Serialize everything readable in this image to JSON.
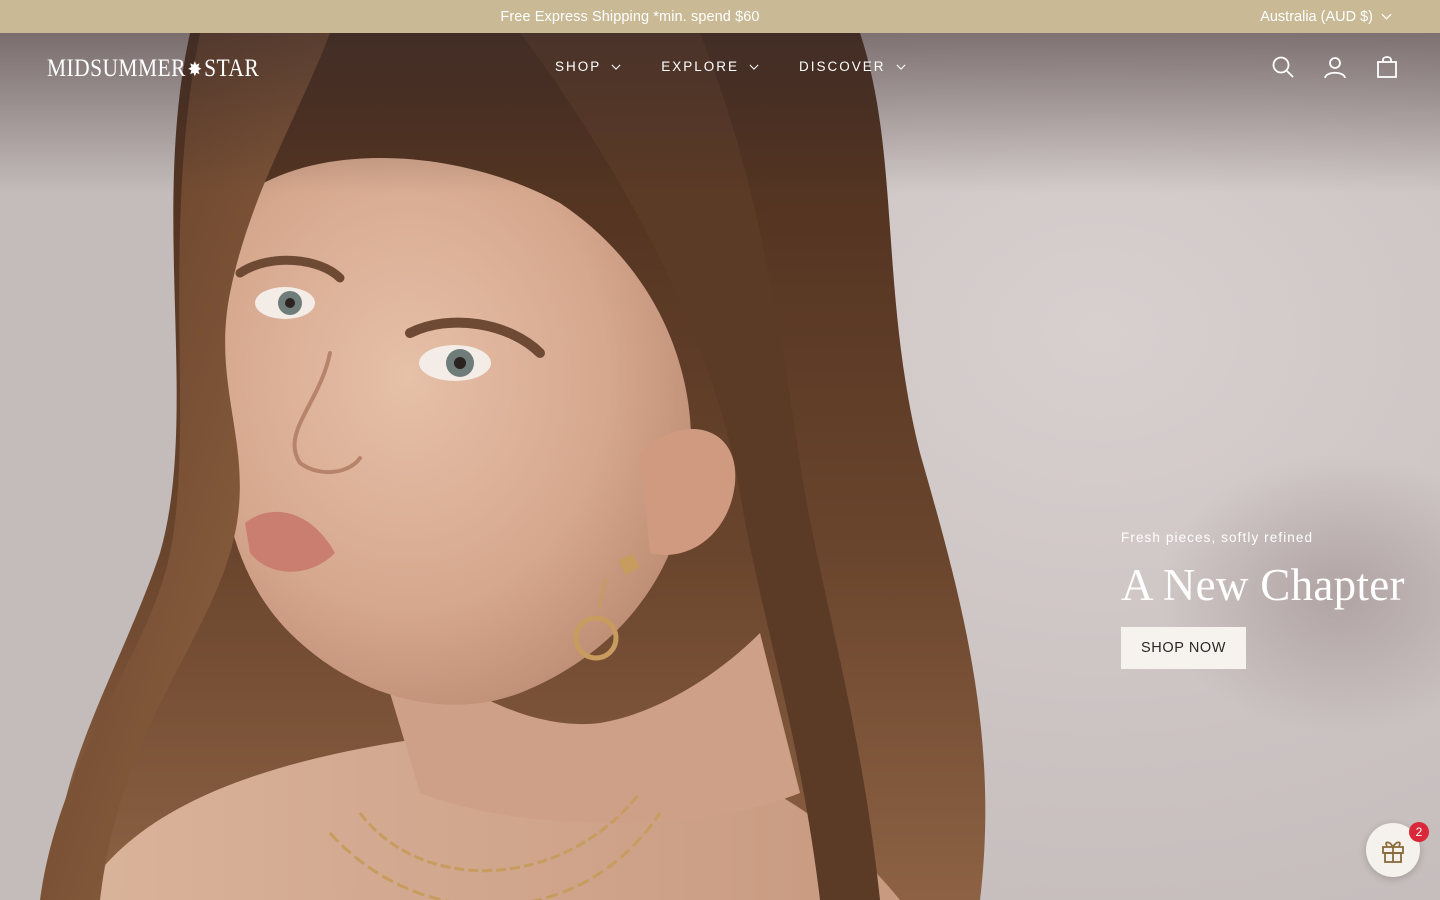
{
  "announcement": {
    "text": "Free Express Shipping *min. spend $60",
    "currency": "Australia (AUD $)"
  },
  "header": {
    "logo_left": "MIDSUMMER",
    "logo_star": "✸",
    "logo_right": "STAR",
    "nav": [
      {
        "label": "SHOP"
      },
      {
        "label": "EXPLORE"
      },
      {
        "label": "DISCOVER"
      }
    ],
    "icons": [
      "search-icon",
      "account-icon",
      "cart-icon"
    ]
  },
  "hero": {
    "eyebrow": "Fresh pieces, softly refined",
    "headline": "A New Chapter",
    "cta": "SHOP NOW"
  },
  "gift_widget": {
    "badge_count": "2",
    "icon": "gift-icon"
  },
  "colors": {
    "announcement_bg": "#c9b995",
    "cta_bg": "#f6f3ee",
    "badge": "#d9283a"
  }
}
